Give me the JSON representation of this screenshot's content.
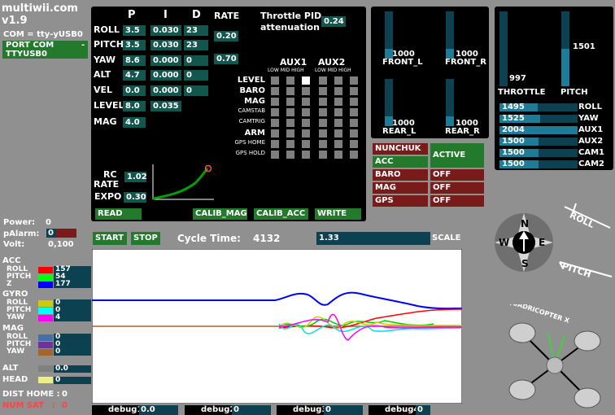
{
  "app": {
    "title": "multiwii.com",
    "version": "v1.9",
    "com_label": "COM = tty-yUSB0",
    "port_line1": "PORT COM",
    "port_dash": "-",
    "port_line2": "TTYUSB0"
  },
  "pid": {
    "headers": {
      "p": "P",
      "i": "I",
      "d": "D",
      "rate": "RATE"
    },
    "rows": [
      {
        "name": "ROLL",
        "p": "3.5",
        "i": "0.030",
        "d": "23"
      },
      {
        "name": "PITCH",
        "p": "3.5",
        "i": "0.030",
        "d": "23"
      },
      {
        "name": "YAW",
        "p": "8.6",
        "i": "0.000",
        "d": "0"
      },
      {
        "name": "ALT",
        "p": "4.7",
        "i": "0.000",
        "d": "0"
      },
      {
        "name": "VEL",
        "p": "0.0",
        "i": "0.000",
        "d": "0"
      },
      {
        "name": "LEVEL",
        "p": "8.0",
        "i": "0.035"
      },
      {
        "name": "MAG",
        "p": "4.0"
      }
    ],
    "rate_roll_pitch": "0.20",
    "rate_yaw": "0.70",
    "throttle_pid_label_1": "Throttle PID",
    "throttle_pid_label_2": "attenuation",
    "throttle_pid_value": "0.24",
    "rc_rate_label_1": "RC",
    "rc_rate_label_2": "RATE",
    "rc_rate_value": "1.02",
    "expo_label": "EXPO",
    "expo_value": "0.30"
  },
  "aux": {
    "aux1": "AUX1",
    "aux2": "AUX2",
    "sub": "LOW MID HIGH",
    "sub1": "LOW MID HIGH",
    "sub2": "LOW MID HIGH",
    "boxes": [
      {
        "name": "LEVEL",
        "small": false,
        "on": [
          2
        ]
      },
      {
        "name": "BARO",
        "small": false,
        "on": []
      },
      {
        "name": "MAG",
        "small": false,
        "on": []
      },
      {
        "name": "CAMSTAB",
        "small": true,
        "on": []
      },
      {
        "name": "CAMTRIG",
        "small": true,
        "on": []
      },
      {
        "name": "ARM",
        "small": false,
        "on": []
      },
      {
        "name": "GPS HOME",
        "small": true,
        "on": []
      },
      {
        "name": "GPS HOLD",
        "small": true,
        "on": []
      }
    ]
  },
  "buttons": {
    "read": "READ",
    "calib_mag": "CALIB_MAG",
    "calib_acc": "CALIB_ACC",
    "write": "WRITE",
    "start": "START",
    "stop": "STOP"
  },
  "motors": {
    "front_l": {
      "label": "FRONT_L",
      "value": "1000",
      "level": 0.2
    },
    "front_r": {
      "label": "FRONT_R",
      "value": "1000",
      "level": 0.2
    },
    "rear_l": {
      "label": "REAR_L",
      "value": "1000",
      "level": 0.2
    },
    "rear_r": {
      "label": "REAR_R",
      "value": "1000",
      "level": 0.2
    }
  },
  "rc": {
    "throttle": {
      "label": "THROTTLE",
      "value": "997",
      "level": 0.0
    },
    "pitch": {
      "label": "PITCH",
      "value": "1501",
      "level": 0.5
    },
    "channels": [
      {
        "name": "ROLL",
        "value": "1495",
        "level": 0.49
      },
      {
        "name": "YAW",
        "value": "1525",
        "level": 0.52
      },
      {
        "name": "AUX1",
        "value": "2004",
        "level": 1.0
      },
      {
        "name": "AUX2",
        "value": "1500",
        "level": 0.5
      },
      {
        "name": "CAM1",
        "value": "1500",
        "level": 0.5
      },
      {
        "name": "CAM2",
        "value": "1500",
        "level": 0.5
      }
    ]
  },
  "sensors_status": [
    {
      "name": "NUNCHUK",
      "state": "",
      "color": "#7a1b1b"
    },
    {
      "name": "ACC",
      "state": "ACTIVE",
      "color": "#237a2d"
    },
    {
      "name": "BARO",
      "state": "OFF",
      "color": "#7a1b1b"
    },
    {
      "name": "MAG",
      "state": "OFF",
      "color": "#7a1b1b"
    },
    {
      "name": "GPS",
      "state": "OFF",
      "color": "#7a1b1b"
    }
  ],
  "power": {
    "power_label": "Power:",
    "power_value": "0",
    "palarm_label": "pAlarm:",
    "palarm_value": "0",
    "volt_label": "Volt:",
    "volt_value": "0,100"
  },
  "cycle": {
    "label": "Cycle Time:",
    "value": "4132",
    "scale_value": "1.33",
    "scale_label": "SCALE"
  },
  "graph_groups": {
    "acc": {
      "title": "ACC",
      "items": [
        {
          "name": "ROLL",
          "color": "#ff0000",
          "value": "157"
        },
        {
          "name": "PITCH",
          "color": "#00ff00",
          "value": "54"
        },
        {
          "name": "Z",
          "color": "#0000ff",
          "value": "177"
        }
      ]
    },
    "gyro": {
      "title": "GYRO",
      "items": [
        {
          "name": "ROLL",
          "color": "#cccc00",
          "value": "0"
        },
        {
          "name": "PITCH",
          "color": "#00ffff",
          "value": "0"
        },
        {
          "name": "YAW",
          "color": "#ff00ff",
          "value": "4"
        }
      ]
    },
    "mag": {
      "title": "MAG",
      "items": [
        {
          "name": "ROLL",
          "color": "#3e72a8",
          "value": "0"
        },
        {
          "name": "PITCH",
          "color": "#7030a0",
          "value": "0"
        },
        {
          "name": "YAW",
          "color": "#a0662a",
          "value": "0"
        }
      ]
    },
    "alt": {
      "title": "ALT",
      "color": "#7f7f7f",
      "value": "0.0"
    },
    "head": {
      "title": "HEAD",
      "color": "#eeee88",
      "value": "0"
    }
  },
  "gps": {
    "dist_home_label": "DIST HOME :",
    "dist_home_value": "0",
    "num_sat_label": "NUM SAT",
    "num_sat_colon": ":",
    "num_sat_value": "0"
  },
  "debug": [
    {
      "label": "debug1",
      "value": "0.0"
    },
    {
      "label": "debug2",
      "value": "0"
    },
    {
      "label": "debug3",
      "value": "0"
    },
    {
      "label": "debug4",
      "value": "0"
    }
  ],
  "attitude": {
    "compass_n": "N",
    "compass_s": "S",
    "compass_e": "E",
    "compass_w": "W",
    "roll_label": "ROLL",
    "pitch_label": "PITCH",
    "quad_label": "QUADRICOPTER X"
  },
  "colors": {
    "panel": "#000000",
    "field": "#13564d",
    "button": "#237a2d",
    "bar_bg": "#0b4150",
    "bar_fill": "#1e7c98",
    "off": "#7a1b1b",
    "num_sat": "#ff4444"
  }
}
